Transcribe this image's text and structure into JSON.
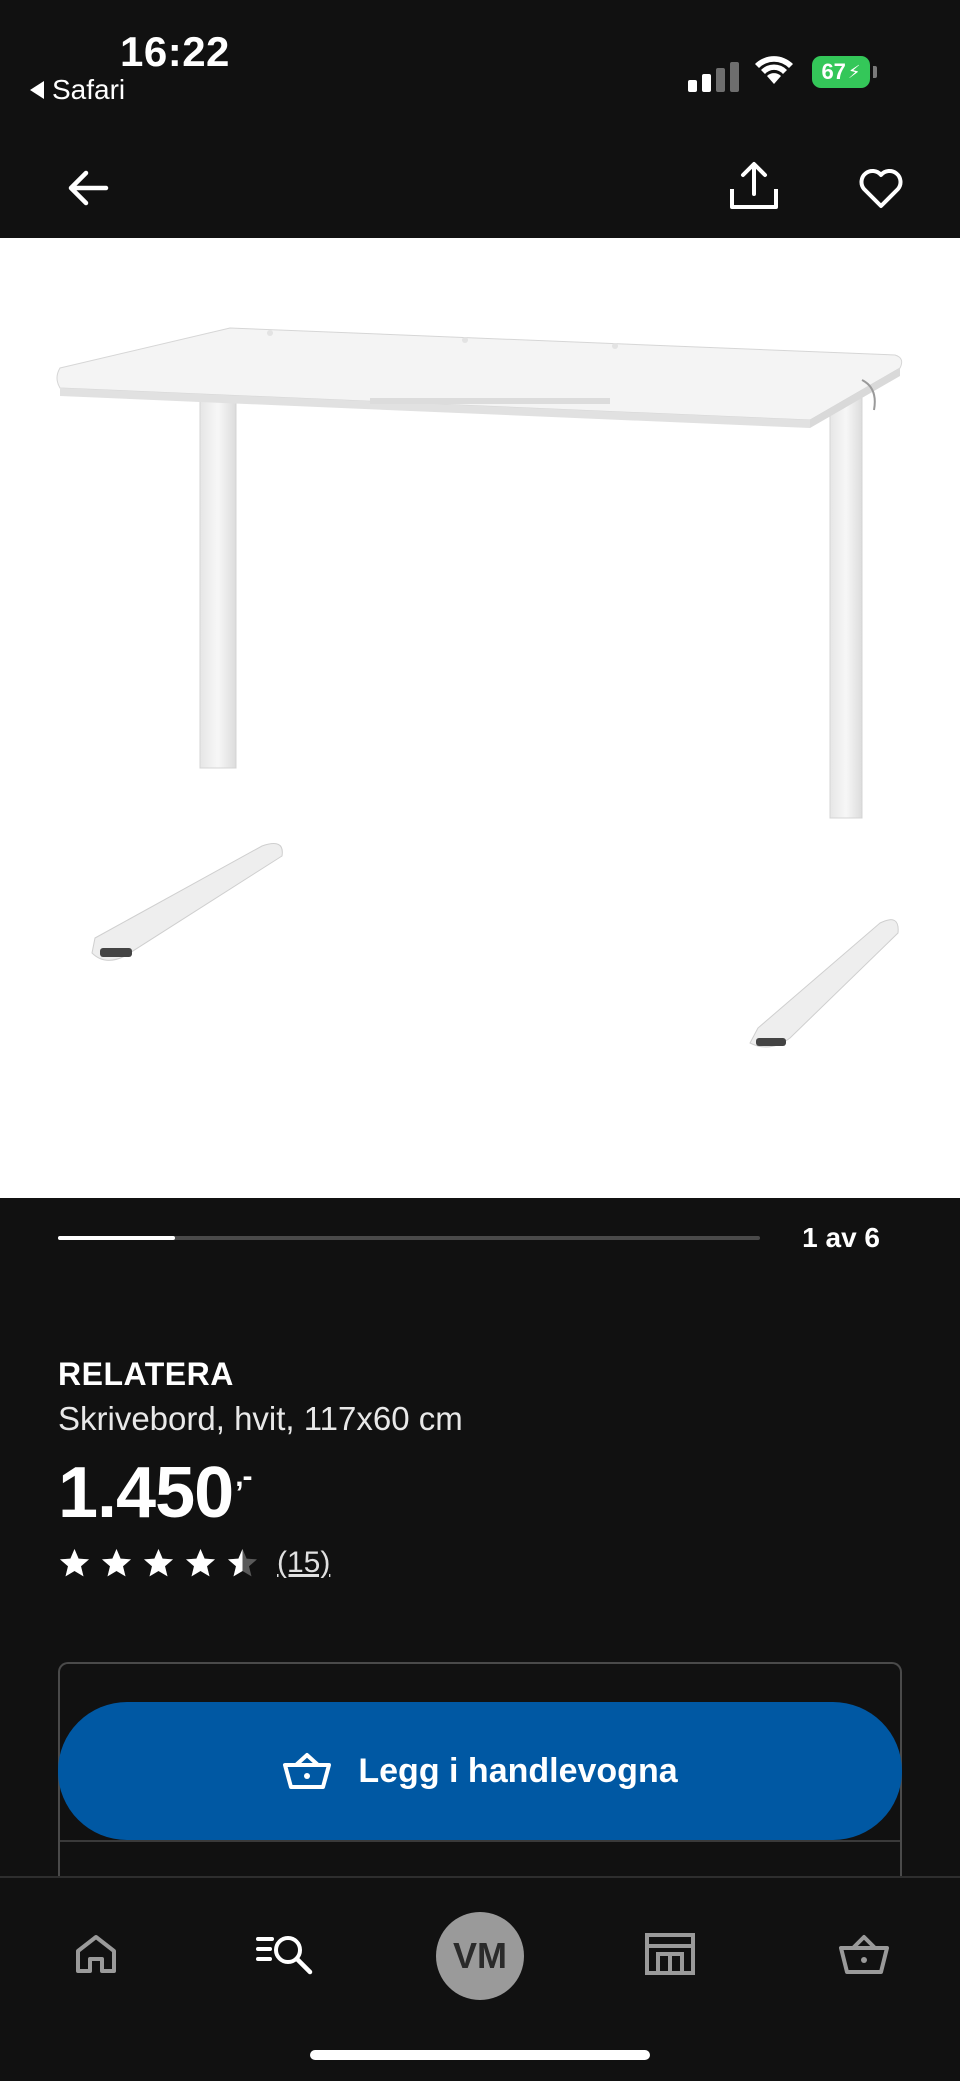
{
  "status_bar": {
    "time": "16:22",
    "back_app": "Safari",
    "battery": "67"
  },
  "header": {
    "back_icon": "arrow-left-icon",
    "share_icon": "share-icon",
    "favorite_icon": "heart-icon"
  },
  "gallery": {
    "counter": "1 av 6",
    "current": 1,
    "total": 6,
    "progress_fraction": 0.167
  },
  "product": {
    "name": "RELATERA",
    "description": "Skrivebord, hvit, 117x60 cm",
    "price": "1.450",
    "price_suffix": ",-",
    "rating_value": 4.5,
    "rating_max": 5,
    "review_count": "(15)"
  },
  "purchase": {
    "add_to_cart_label": "Legg i handlevogna",
    "button_color": "#0058a3"
  },
  "bottom_nav": {
    "items": [
      {
        "icon": "home-icon"
      },
      {
        "icon": "search-list-icon"
      },
      {
        "label": "VM"
      },
      {
        "icon": "store-icon"
      },
      {
        "icon": "basket-icon"
      }
    ]
  }
}
